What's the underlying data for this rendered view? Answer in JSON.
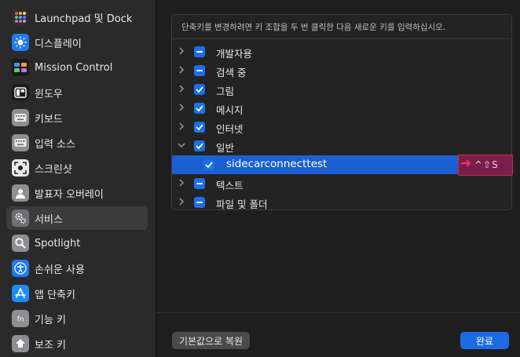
{
  "sidebar": {
    "items": [
      {
        "label": "Launchpad 및 Dock",
        "icon": "launchpad-icon"
      },
      {
        "label": "디스플레이",
        "icon": "display-icon"
      },
      {
        "label": "Mission Control",
        "icon": "mission-control-icon"
      },
      {
        "label": "윈도우",
        "icon": "window-icon"
      },
      {
        "label": "키보드",
        "icon": "keyboard-icon"
      },
      {
        "label": "입력 소스",
        "icon": "input-source-icon"
      },
      {
        "label": "스크린샷",
        "icon": "screenshot-icon"
      },
      {
        "label": "발표자 오버레이",
        "icon": "presenter-overlay-icon"
      },
      {
        "label": "서비스",
        "icon": "services-gear-icon"
      },
      {
        "label": "Spotlight",
        "icon": "spotlight-icon"
      },
      {
        "label": "손쉬운 사용",
        "icon": "accessibility-icon"
      },
      {
        "label": "앱 단축키",
        "icon": "app-store-icon"
      },
      {
        "label": "기능 키",
        "icon": "fn-key-icon"
      },
      {
        "label": "보조 키",
        "icon": "modifier-key-icon"
      }
    ]
  },
  "panel": {
    "hint": "단축키를 변경하려면 키 조합을 두 번 클릭한 다음 새로운 키를 입력하십시오.",
    "rows": [
      {
        "label": "개발자용",
        "state": "mixed",
        "expanded": false
      },
      {
        "label": "검색 중",
        "state": "mixed",
        "expanded": false
      },
      {
        "label": "그림",
        "state": "checked",
        "expanded": false
      },
      {
        "label": "메시지",
        "state": "checked",
        "expanded": false
      },
      {
        "label": "인터넷",
        "state": "checked",
        "expanded": false
      },
      {
        "label": "일반",
        "state": "checked",
        "expanded": true
      },
      {
        "label": "sidecarconnecttest",
        "state": "checked",
        "child": true,
        "selected": true,
        "shortcut": "^⇧S"
      },
      {
        "label": "텍스트",
        "state": "mixed",
        "expanded": false
      },
      {
        "label": "파일 및 폴더",
        "state": "mixed",
        "expanded": false
      }
    ]
  },
  "footer": {
    "reset_label": "기본값으로 복원",
    "done_label": "완료"
  },
  "colors": {
    "accent": "#1e6fe8",
    "selection": "#1c5fd2",
    "shortcut_highlight": "#7a1e4a"
  }
}
